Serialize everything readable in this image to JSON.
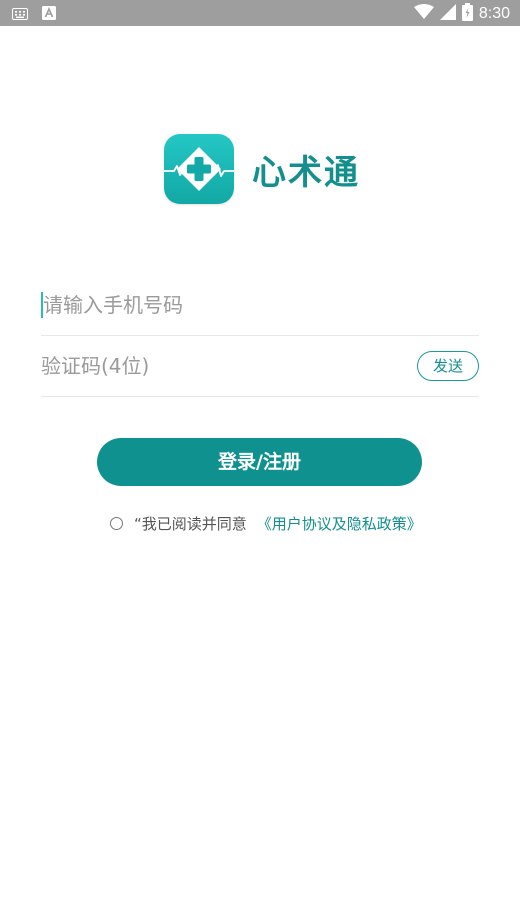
{
  "status_bar": {
    "time": "8:30",
    "icons": [
      "keyboard-icon",
      "a-notification-icon",
      "wifi-icon",
      "signal-icon",
      "battery-icon"
    ]
  },
  "app": {
    "name": "心术通",
    "icon": "medical-cross-heartbeat-icon"
  },
  "login_form": {
    "phone_placeholder": "请输入手机号码",
    "code_placeholder": "验证码(4位)",
    "send_button_label": "发送",
    "submit_label": "登录/注册"
  },
  "agreement": {
    "text": "“我已阅读并同意",
    "link": "《用户协议及隐私政策》",
    "checked": false
  },
  "colors": {
    "primary": "#0f918f",
    "accent_text": "#138f8e",
    "status_bar": "#9e9e9e"
  }
}
